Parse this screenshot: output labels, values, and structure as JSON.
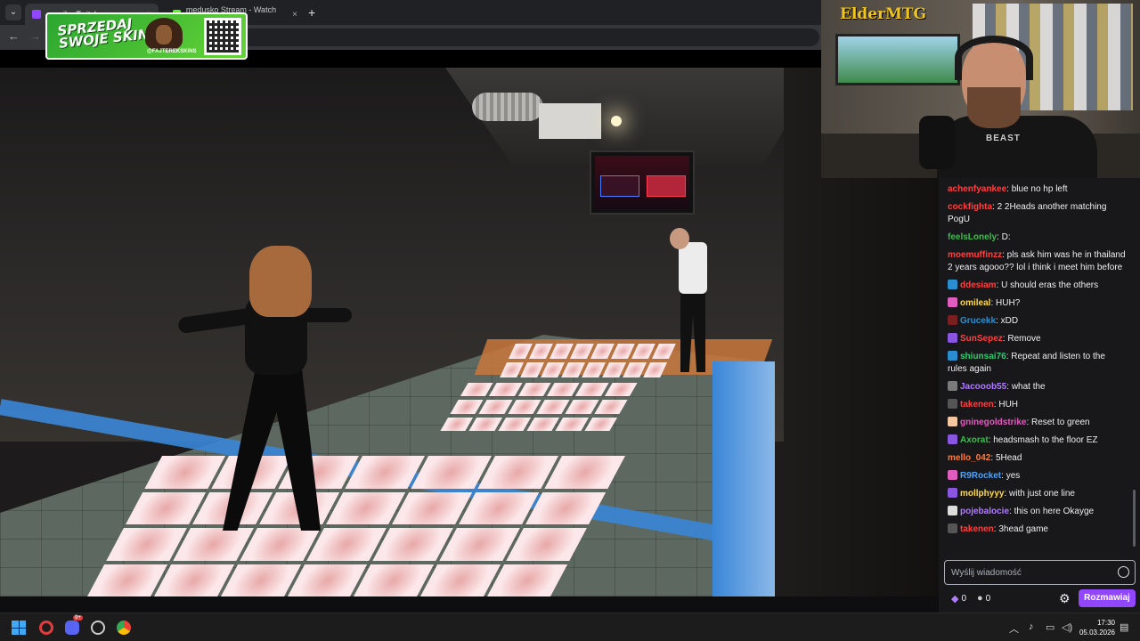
{
  "browser": {
    "tabs": [
      {
        "label": "osnsik - Twitch",
        "favicon_color": "#9147ff",
        "active": true
      },
      {
        "label": "medusko Stream - Watch Live o",
        "favicon_color": "#53fc18",
        "active": false
      }
    ],
    "tab_close": "×",
    "new_tab": "+",
    "back": "←",
    "forward": "→"
  },
  "ad": {
    "line1": "SPRZEDAJ",
    "line2": "SWOJE SKINY",
    "handle": "@FAJTEREKSKINS"
  },
  "webcam": {
    "logo": "ElderMTG",
    "shirt_print": "BEAST"
  },
  "chat": {
    "messages": [
      {
        "user": "achenfyankee",
        "color": "#ff4040",
        "text": "blue no hp left",
        "badge": ""
      },
      {
        "user": "cockfighta",
        "color": "#ff4040",
        "text": "2 2Heads another matching PogU",
        "badge": ""
      },
      {
        "user": "feelsLonely",
        "color": "#3fb950",
        "text": "D:",
        "badge": ""
      },
      {
        "user": "moemuffinzz",
        "color": "#ff4040",
        "text": "pls ask him was he in thailand 2 years agooo?? lol i think i meet him before",
        "badge": ""
      },
      {
        "user": "ddesiam",
        "color": "#ff4040",
        "text": "U should eras the others",
        "badge": "#2a8fd0"
      },
      {
        "user": "omileal",
        "color": "#ffd94a",
        "text": "HUH?",
        "badge": "#e05cbe"
      },
      {
        "user": "Grucekk",
        "color": "#2a8fd0",
        "text": "xDD",
        "badge": "#7a1f1f"
      },
      {
        "user": "SunSepez",
        "color": "#ff4040",
        "text": "Remove",
        "badge": "#8a55e0"
      },
      {
        "user": "shiunsai76",
        "color": "#2ecc71",
        "text": "Repeat and listen to the rules again",
        "badge": "#2a8fd0"
      },
      {
        "user": "Jacooob55",
        "color": "#b07cff",
        "text": "what the",
        "badge": "#7a7a7a"
      },
      {
        "user": "takenen",
        "color": "#ff4040",
        "text": "HUH",
        "badge": "#555555"
      },
      {
        "user": "gninegoldstrike",
        "color": "#e05cbe",
        "text": "Reset to green",
        "badge": "#f4c7a1"
      },
      {
        "user": "Axorat",
        "color": "#3fb950",
        "text": "headsmash to the floor EZ",
        "badge": "#8a55e0"
      },
      {
        "user": "mello_042",
        "color": "#ff7a3d",
        "text": "5Head",
        "badge": ""
      },
      {
        "user": "R9Rocket",
        "color": "#4aa3ff",
        "text": "yes",
        "badge": "#e05cbe"
      },
      {
        "user": "mollphyyy",
        "color": "#ffd94a",
        "text": "with just one line",
        "badge": "#8a55e0"
      },
      {
        "user": "pojebalocie",
        "color": "#b07cff",
        "text": "this on here Okayge",
        "badge": "#dddddd"
      },
      {
        "user": "takenen",
        "color": "#ff4040",
        "text": "3head game",
        "badge": "#555555"
      }
    ],
    "input_placeholder": "Wyślij wiadomość",
    "bits_count": "0",
    "points_count": "0",
    "chat_button": "Rozmawiaj"
  },
  "taskbar": {
    "time": "17:30",
    "date": "05.03.2026",
    "discord_badge": "9+"
  },
  "colors": {
    "twitch_purple": "#9147ff",
    "chat_bg": "#18181b"
  }
}
